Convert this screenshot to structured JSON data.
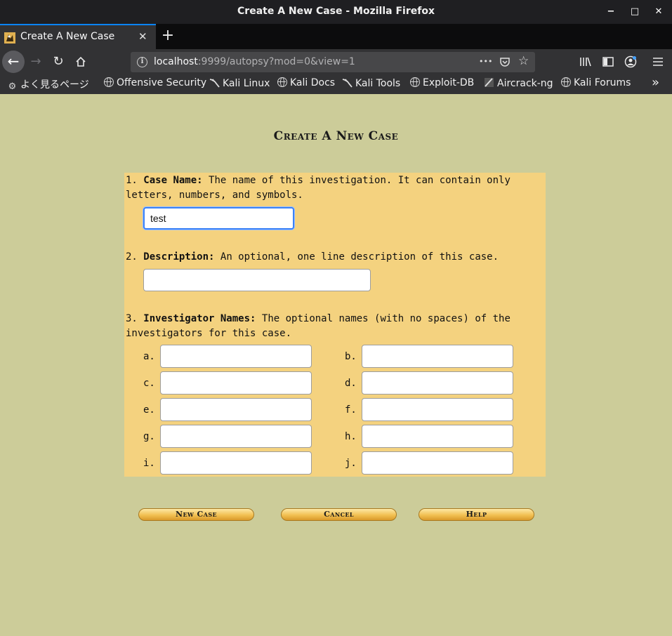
{
  "window": {
    "title": "Create A New Case - Mozilla Firefox",
    "minimize_glyph": "−",
    "maximize_glyph": "□",
    "close_glyph": "✕"
  },
  "tab": {
    "label": "Create A New Case",
    "close_glyph": "✕",
    "new_tab_glyph": "+"
  },
  "navbar": {
    "url_host": "localhost",
    "url_rest": ":9999/autopsy?mod=0&view=1",
    "more_glyph": "•••",
    "icons": [
      "back-icon",
      "forward-icon",
      "reload-icon",
      "home-icon",
      "page-info-icon",
      "page-actions-icon",
      "pocket-icon",
      "bookmark-star-icon",
      "library-icon",
      "sidebar-icon",
      "account-icon",
      "menu-icon"
    ]
  },
  "bookmarks": {
    "items": [
      {
        "label": "よく見るページ",
        "icon": "gear-icon"
      },
      {
        "label": "Offensive Security",
        "icon": "globe-icon"
      },
      {
        "label": "Kali Linux",
        "icon": "kali-dragon-icon"
      },
      {
        "label": "Kali Docs",
        "icon": "globe-icon"
      },
      {
        "label": "Kali Tools",
        "icon": "kali-dragon-icon"
      },
      {
        "label": "Exploit-DB",
        "icon": "globe-icon"
      },
      {
        "label": "Aircrack-ng",
        "icon": "aircrack-icon"
      },
      {
        "label": "Kali Forums",
        "icon": "globe-icon"
      }
    ],
    "overflow_glyph": "»"
  },
  "page": {
    "title": "Create A New Case",
    "case_name": {
      "number": "1.",
      "label": "Case Name:",
      "text_line1": "The name of this investigation. It can contain only",
      "text_line2": "letters, numbers, and symbols.",
      "value": "test"
    },
    "description": {
      "number": "2.",
      "label": "Description:",
      "text": "An optional, one line description of this case.",
      "value": ""
    },
    "investigators": {
      "number": "3.",
      "label": "Investigator Names:",
      "text_line1": "The optional names (with no spaces) of the",
      "text_line2": "investigators for this case.",
      "fields": [
        {
          "letter": "a.",
          "value": ""
        },
        {
          "letter": "b.",
          "value": ""
        },
        {
          "letter": "c.",
          "value": ""
        },
        {
          "letter": "d.",
          "value": ""
        },
        {
          "letter": "e.",
          "value": ""
        },
        {
          "letter": "f.",
          "value": ""
        },
        {
          "letter": "g.",
          "value": ""
        },
        {
          "letter": "h.",
          "value": ""
        },
        {
          "letter": "i.",
          "value": ""
        },
        {
          "letter": "j.",
          "value": ""
        }
      ]
    },
    "buttons": {
      "new_case": "New Case",
      "cancel": "Cancel",
      "help": "Help"
    }
  },
  "colors": {
    "page_bg": "#cccc99",
    "form_bg": "#f4d27f",
    "focus_ring": "#3c82f5",
    "chrome_dark": "#323234"
  }
}
